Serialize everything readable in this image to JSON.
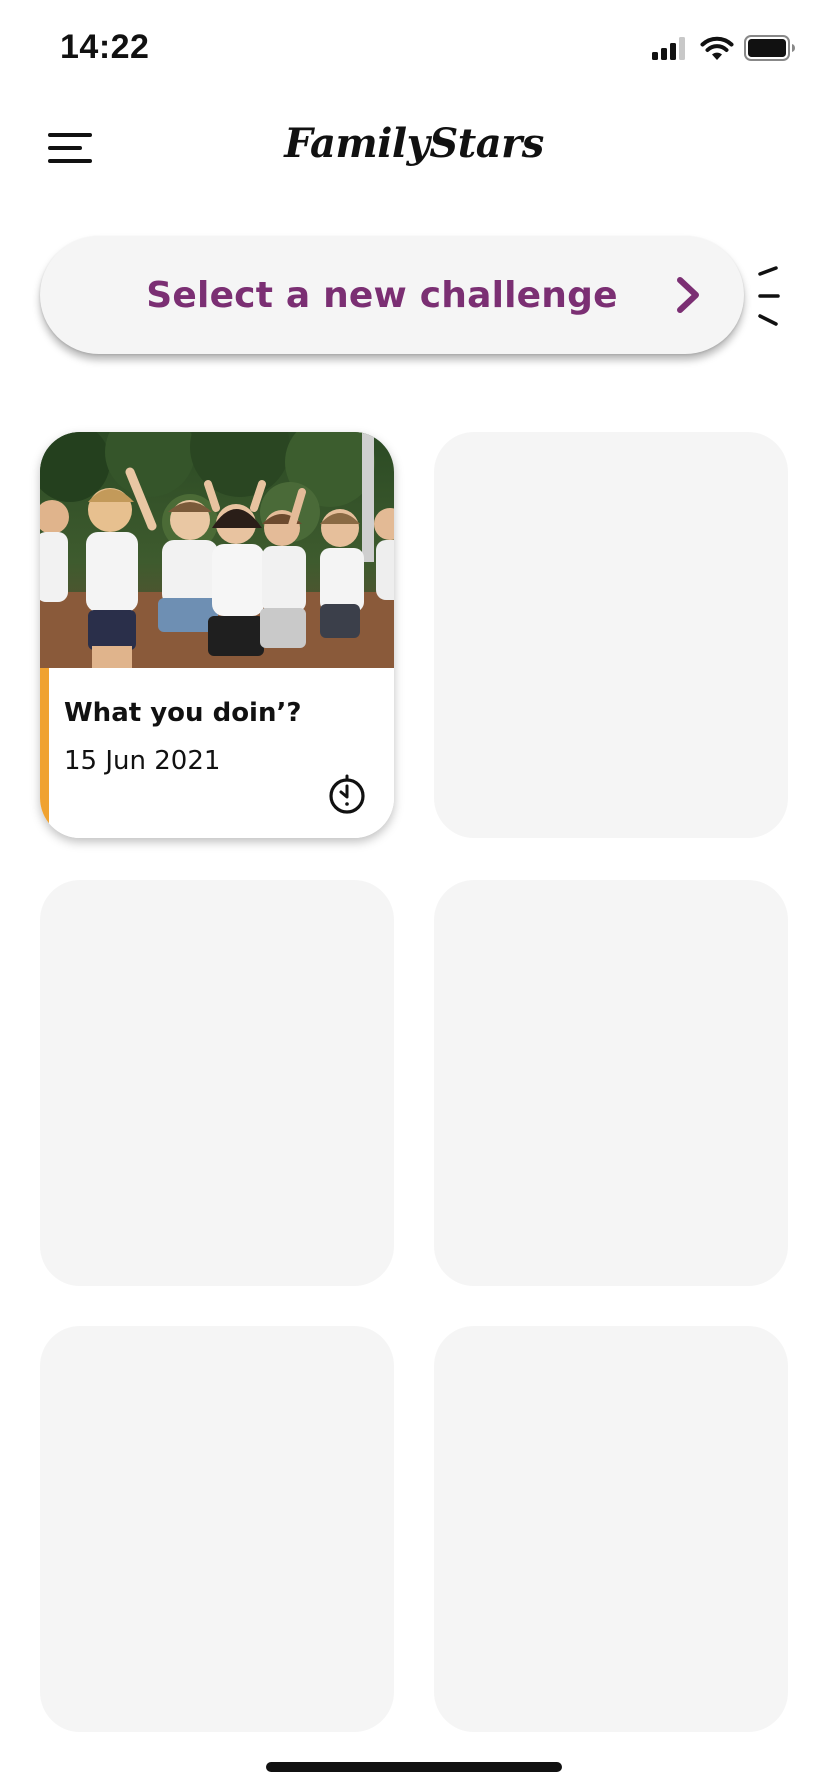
{
  "status_bar": {
    "time": "14:22",
    "icons": [
      "cellular-signal-icon",
      "wifi-icon",
      "battery-icon"
    ]
  },
  "header": {
    "menu_icon": "hamburger-menu-icon",
    "app_name": "FamilyStars"
  },
  "challenge_selector": {
    "label": "Select a new challenge",
    "chevron_icon": "chevron-right-icon"
  },
  "challenges": [
    {
      "title": "What you doin’?",
      "date": "15 Jun 2021",
      "status_icon": "timer-icon",
      "has_photo": true
    }
  ],
  "placeholder_count": 5,
  "colors": {
    "accent_purple": "#7b2f73",
    "accent_orange": "#f0a230",
    "placeholder_gray": "#f5f5f5",
    "text_dark": "#111111"
  }
}
